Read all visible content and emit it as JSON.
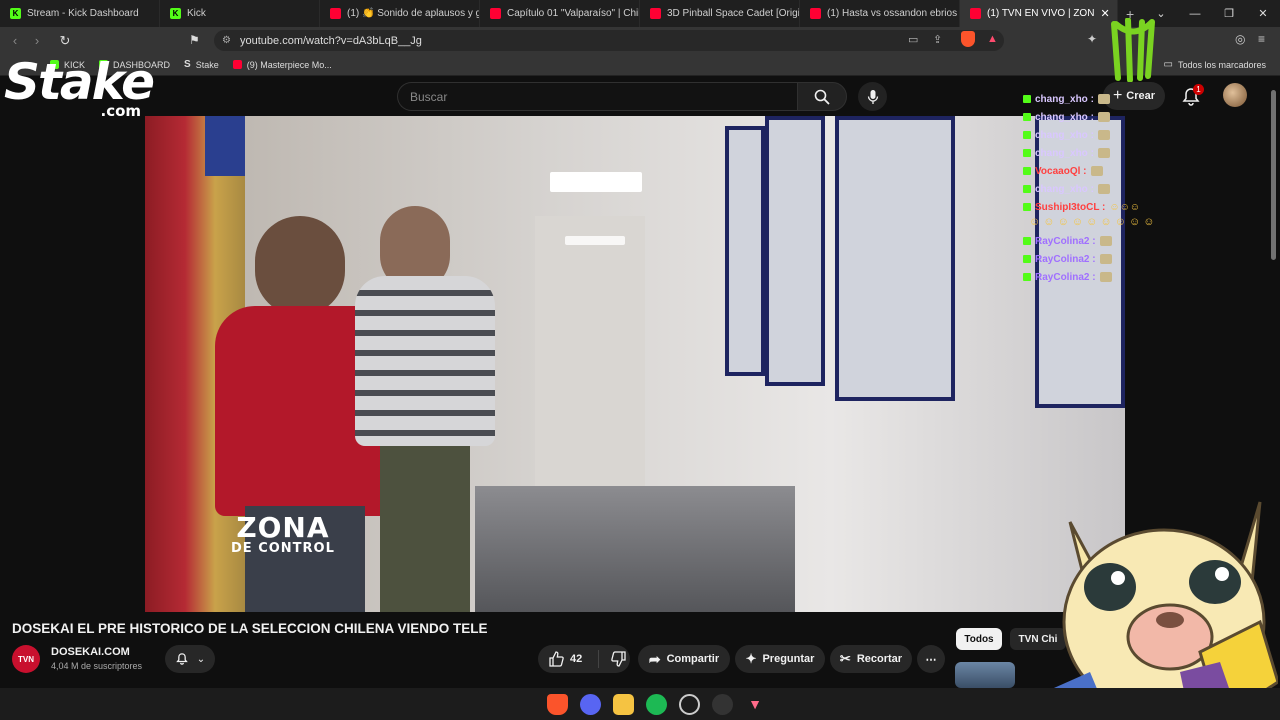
{
  "browser": {
    "tabs": [
      {
        "title": "Stream - Kick Dashboard",
        "icon": "kick-icon"
      },
      {
        "title": "Kick",
        "icon": "kick-icon"
      },
      {
        "title": "(1) 👏 Sonido de aplausos y g",
        "icon": "youtube-icon"
      },
      {
        "title": "Capítulo 01 \"Valparaíso\" | Chile",
        "icon": "youtube-icon"
      },
      {
        "title": "3D Pinball Space Cadet [Origin",
        "icon": "youtube-icon"
      },
      {
        "title": "(1) Hasta vs ossandon ebrios",
        "icon": "youtube-icon"
      },
      {
        "title": "(1) TVN EN VIVO | ZON",
        "icon": "youtube-icon",
        "active": true
      }
    ],
    "url": "youtube.com/watch?v=dA3bLqB__Jg",
    "bookmarks": [
      {
        "label": "KICK",
        "icon": "kick-icon"
      },
      {
        "label": "DASHBOARD",
        "icon": "kick-icon"
      },
      {
        "label": "Stake",
        "icon": "stake-icon"
      },
      {
        "label": "(9) Masterpiece Mo...",
        "icon": "youtube-icon"
      }
    ],
    "all_bookmarks": "Todos los marcadores",
    "accent_kick": "#53fc18",
    "accent_youtube": "#ff0033"
  },
  "youtube": {
    "search_placeholder": "Buscar",
    "create_label": "Crear",
    "notification_count": "1",
    "video_title": "DOSEKAI EL PRE HISTORICO DE LA SELECCION CHILENA VIENDO TELE",
    "channel_logo": "TVN",
    "channel_name": "DOSEKAI.COM",
    "subscribers": "4,04 M de suscriptores",
    "likes": "42",
    "share_label": "Compartir",
    "ask_label": "Preguntar",
    "clip_label": "Recortar",
    "chips": [
      "Todos",
      "TVN Chi"
    ],
    "overlay_line1": "ZONA",
    "overlay_line2": "DE CONTROL"
  },
  "overlay": {
    "stake_logo": "Stake",
    "stake_sub": ".com",
    "chat": [
      {
        "user": "chang_xho :",
        "color": "#d9c7ff"
      },
      {
        "user": "chang_xho :",
        "color": "#d9c7ff"
      },
      {
        "user": "chang_xho :",
        "color": "#d9c7ff"
      },
      {
        "user": "chang_xho :",
        "color": "#d9c7ff"
      },
      {
        "user": "VocaaoQl :",
        "color": "#ff4040"
      },
      {
        "user": "chang_xho :",
        "color": "#d9c7ff"
      },
      {
        "user": "SushipI3toCL :",
        "color": "#ff4040"
      }
    ],
    "chat_after": [
      {
        "user": "RayColina2 :",
        "color": "#a070ff"
      },
      {
        "user": "RayColina2 :",
        "color": "#a070ff"
      },
      {
        "user": "RayColina2 :",
        "color": "#a070ff"
      }
    ]
  }
}
